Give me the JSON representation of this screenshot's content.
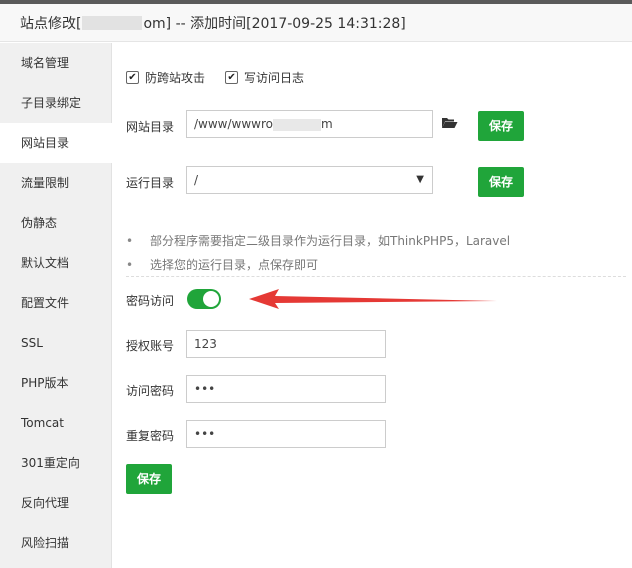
{
  "window": {
    "title_prefix": "站点修改[",
    "title_suffix": "om] -- 添加时间[2017-09-25 14:31:28]"
  },
  "sidebar": {
    "items": [
      {
        "label": "域名管理"
      },
      {
        "label": "子目录绑定"
      },
      {
        "label": "网站目录"
      },
      {
        "label": "流量限制"
      },
      {
        "label": "伪静态"
      },
      {
        "label": "默认文档"
      },
      {
        "label": "配置文件"
      },
      {
        "label": "SSL"
      },
      {
        "label": "PHP版本"
      },
      {
        "label": "Tomcat"
      },
      {
        "label": "301重定向"
      },
      {
        "label": "反向代理"
      },
      {
        "label": "风险扫描"
      }
    ],
    "active_index": 2
  },
  "options": {
    "anti_cross_site_label": "防跨站攻击",
    "anti_cross_site_checked": true,
    "access_log_label": "写访问日志",
    "access_log_checked": true
  },
  "site_dir": {
    "label": "网站目录",
    "value_prefix": "/www/wwwro",
    "value_suffix": "m",
    "save_label": "保存"
  },
  "run_dir": {
    "label": "运行目录",
    "value": "/",
    "save_label": "保存"
  },
  "tips": [
    "部分程序需要指定二级目录作为运行目录，如ThinkPHP5，Laravel",
    "选择您的运行目录，点保存即可"
  ],
  "password_access": {
    "label": "密码访问",
    "enabled": true,
    "account_label": "授权账号",
    "account_value": "123",
    "password_label": "访问密码",
    "password_value": "•••",
    "repeat_label": "重复密码",
    "repeat_value": "•••",
    "save_label": "保存"
  },
  "colors": {
    "accent": "#20a53a",
    "annotation_arrow": "#e53935"
  },
  "icons": {
    "folder": "folder-open-icon",
    "select": "caret-down-icon",
    "check": "check-icon"
  }
}
